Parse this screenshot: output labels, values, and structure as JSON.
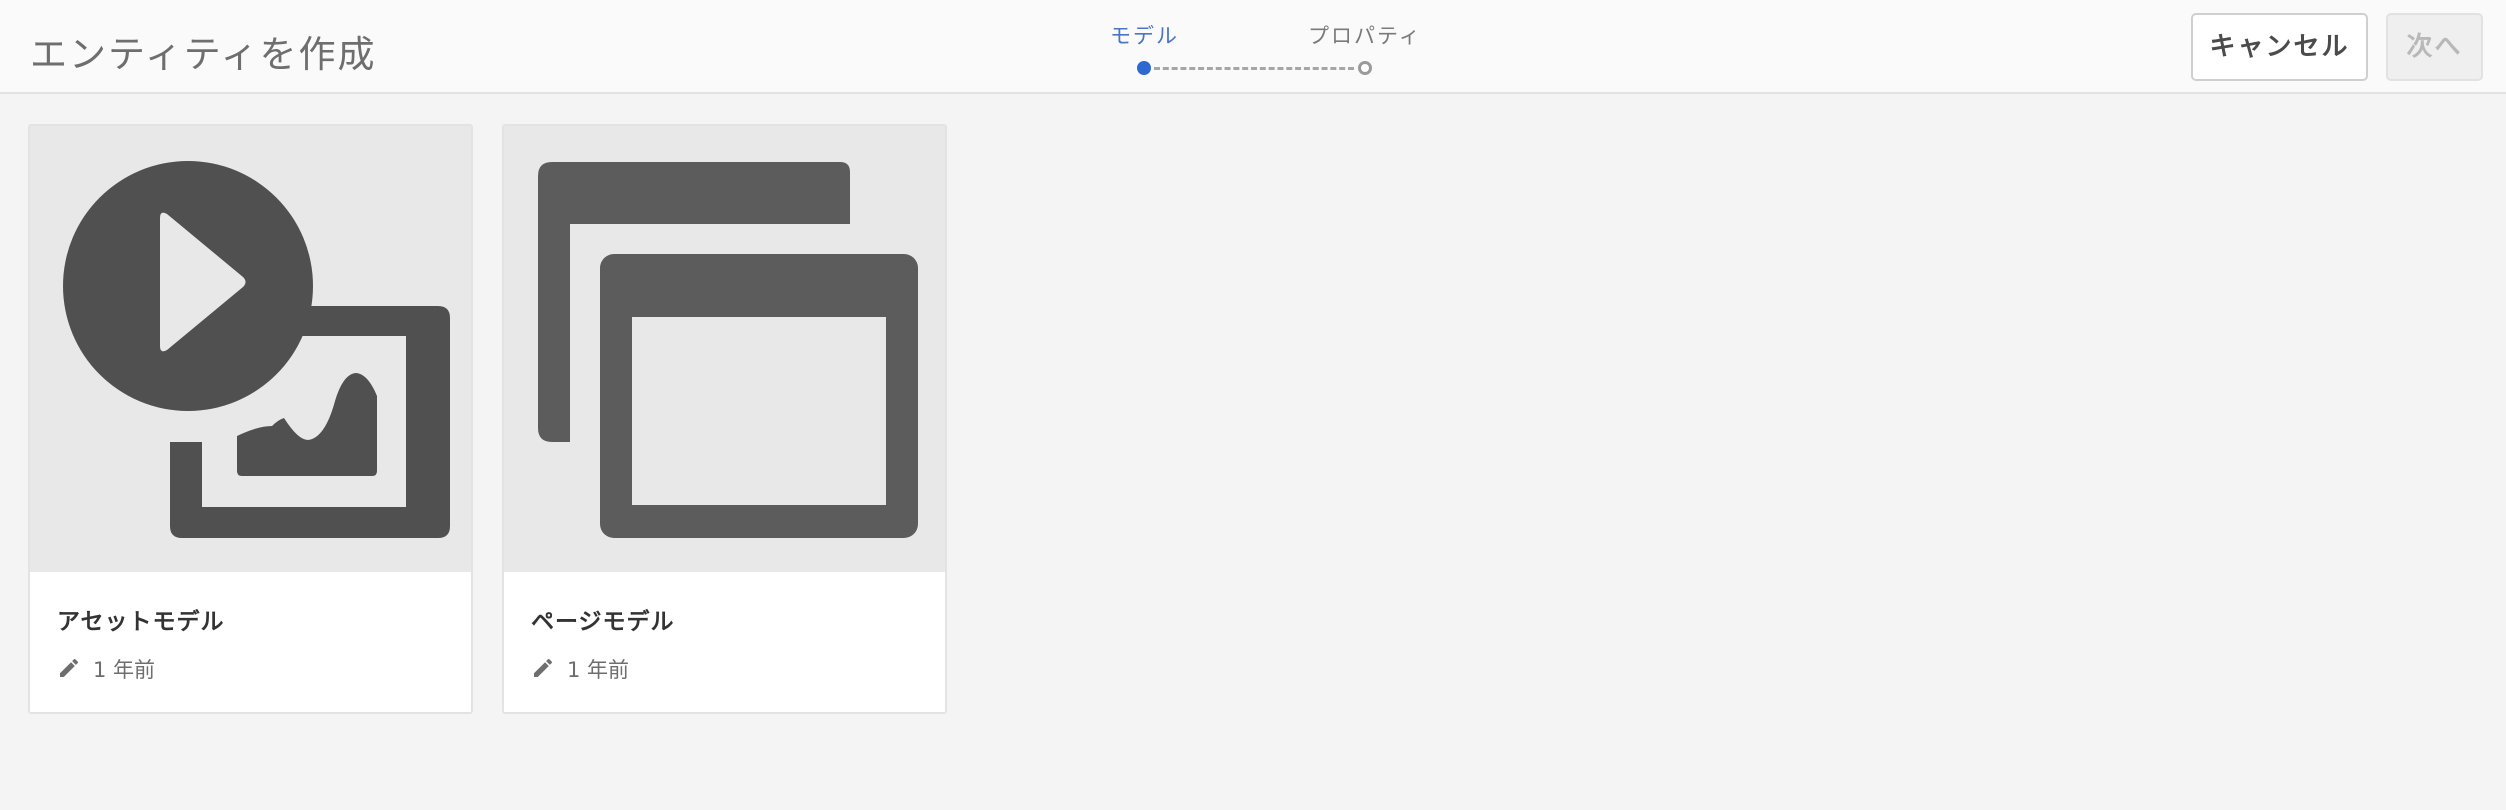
{
  "header": {
    "title": "エンティティを作成",
    "wizard": {
      "steps": [
        {
          "label": "モデル",
          "state": "active"
        },
        {
          "label": "プロパティ",
          "state": "inactive"
        }
      ]
    },
    "cancel_label": "キャンセル",
    "next_label": "次へ"
  },
  "cards": [
    {
      "title": "アセットモデル",
      "modified": "1 年前",
      "icon": "asset-media-icon"
    },
    {
      "title": "ページモデル",
      "modified": "1 年前",
      "icon": "page-windows-icon"
    }
  ],
  "colors": {
    "accent": "#2f68d0",
    "icon_gray": "#505050",
    "background": "#f4f4f4"
  }
}
